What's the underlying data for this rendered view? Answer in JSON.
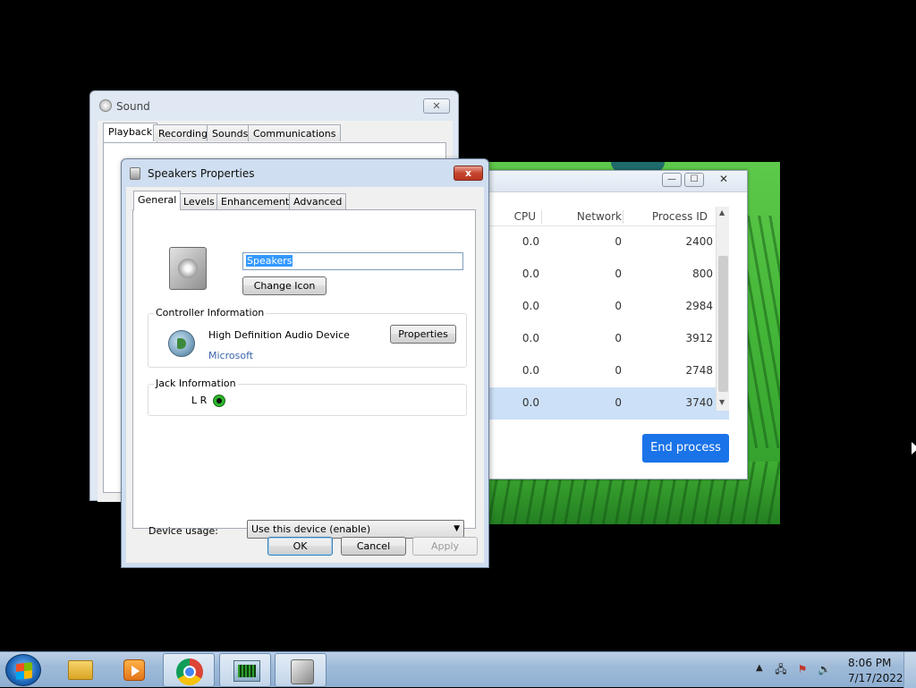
{
  "task_window": {
    "minimize": "—",
    "maximize": "☐",
    "close": "✕",
    "columns": {
      "cpu": "CPU",
      "network": "Network",
      "pid": "Process ID"
    },
    "rows": [
      {
        "cpu": "0.0",
        "network": "0",
        "pid": "2400"
      },
      {
        "cpu": "0.0",
        "network": "0",
        "pid": "800"
      },
      {
        "cpu": "0.0",
        "network": "0",
        "pid": "2984"
      },
      {
        "cpu": "0.0",
        "network": "0",
        "pid": "3912"
      },
      {
        "cpu": "0.0",
        "network": "0",
        "pid": "2748"
      },
      {
        "cpu": "0.0",
        "network": "0",
        "pid": "3740"
      }
    ],
    "selected_row": 5,
    "end_process_label": "End process",
    "accent_color": "#1a73e8"
  },
  "sound_window": {
    "title": "Sound",
    "close": "✕",
    "tabs": [
      "Playback",
      "Recording",
      "Sounds",
      "Communications"
    ],
    "active_tab": "Playback"
  },
  "properties_window": {
    "title": "Speakers Properties",
    "close": "x",
    "tabs": [
      "General",
      "Levels",
      "Enhancements",
      "Advanced"
    ],
    "active_tab": "General",
    "device_name": "Speakers",
    "change_icon_label": "Change Icon",
    "controller": {
      "legend": "Controller Information",
      "name": "High Definition Audio Device",
      "vendor": "Microsoft",
      "properties_label": "Properties"
    },
    "jack": {
      "legend": "Jack Information",
      "channels": "L R",
      "color": "#2bb52b"
    },
    "device_usage": {
      "label": "Device usage:",
      "value": "Use this device (enable)"
    },
    "buttons": {
      "ok": "OK",
      "cancel": "Cancel",
      "apply": "Apply"
    }
  },
  "taskbar": {
    "items": [
      "start-orb-icon",
      "folder-icon",
      "media-player-icon",
      "chrome-icon",
      "task-manager-icon",
      "speaker-icon"
    ],
    "tray": {
      "arrow": "▲",
      "network_icon": "🖧",
      "flag_icon": "⚑",
      "volume_icon": "🔊"
    },
    "time": "8:06 PM",
    "date": "7/17/2022"
  }
}
